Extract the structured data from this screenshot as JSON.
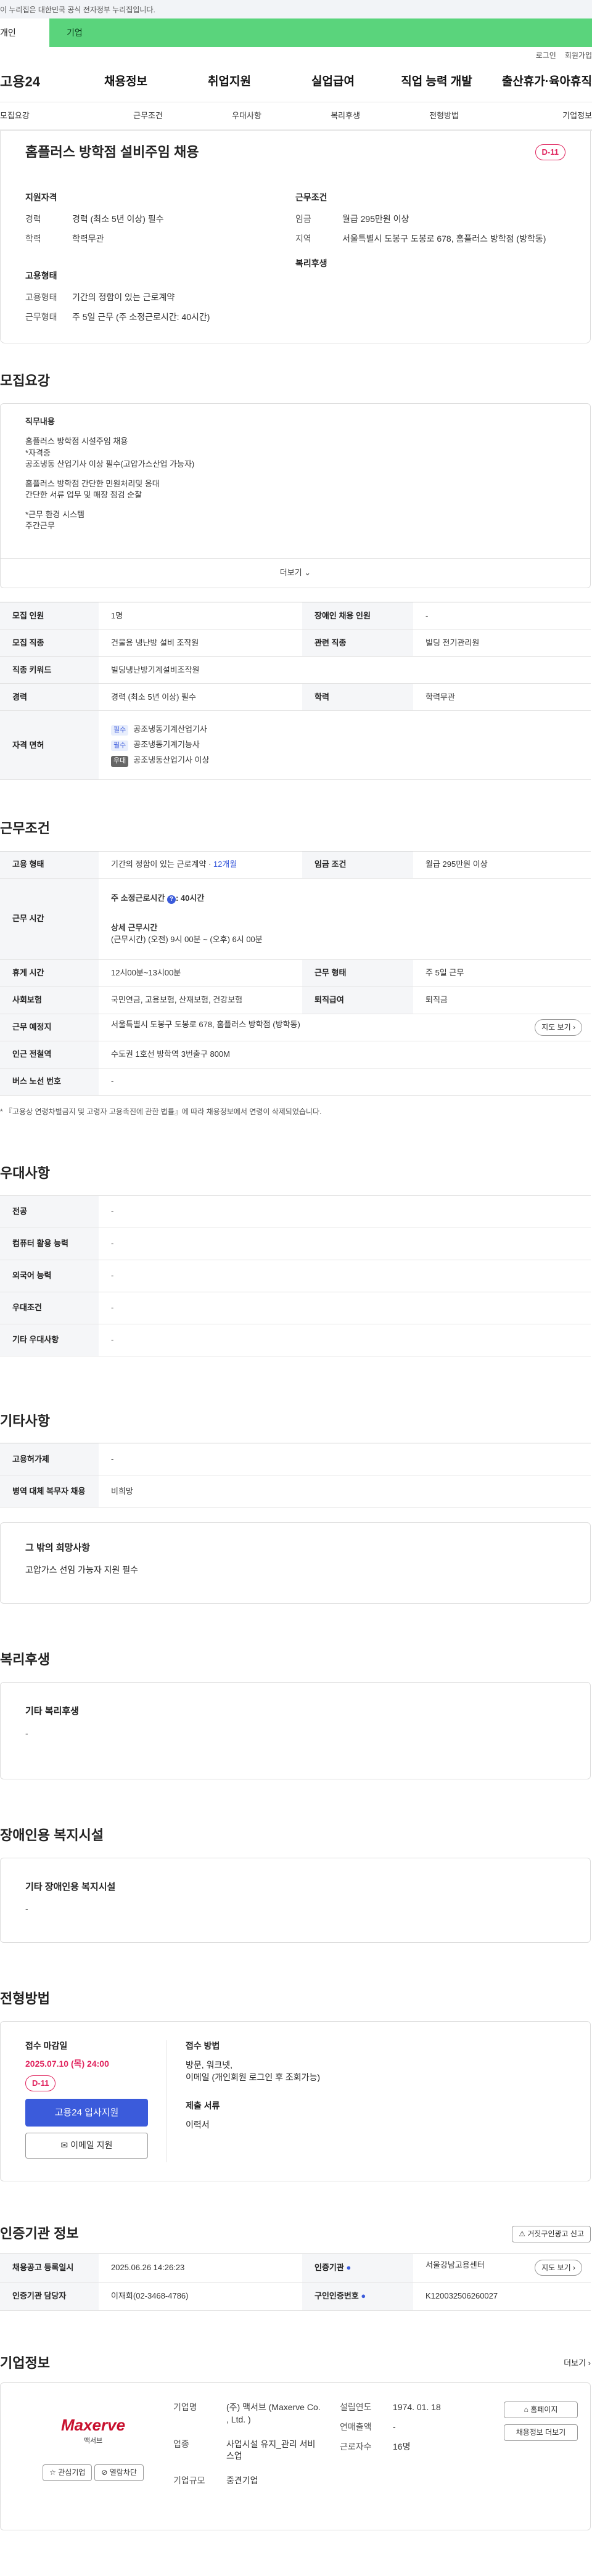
{
  "gov_banner": "이 누리집은 대한민국 공식 전자정부 누리집입니다.",
  "top_tabs": [
    "개인",
    "기업"
  ],
  "util_links": [
    "로그인",
    "회원가입"
  ],
  "logo": "고용24",
  "gnb": [
    "채용정보",
    "취업지원",
    "실업급여",
    "직업 능력 개발",
    "출산휴가·육아휴직"
  ],
  "anchor_tabs": [
    "모집요강",
    "근무조건",
    "우대사항",
    "복리후생",
    "전형방법",
    "기업정보"
  ],
  "summary": {
    "title": "홈플러스 방학점 설비주임 채용",
    "dday": "D-11",
    "qual_head": "지원자격",
    "qual": [
      {
        "k": "경력",
        "v": "경력 (최소 5년 이상) 필수"
      },
      {
        "k": "학력",
        "v": "학력무관"
      }
    ],
    "cond_head": "근무조건",
    "cond": [
      {
        "k": "임금",
        "v": "월급 295만원 이상"
      },
      {
        "k": "지역",
        "v": "서울특별시 도봉구 도봉로 678, 홈플러스 방학점 (방학동)"
      }
    ],
    "emp_head": "고용형태",
    "emp": [
      {
        "k": "고용형태",
        "v": "기간의 정함이 있는 근로계약"
      },
      {
        "k": "근무형태",
        "v": "주 5일 근무 (주 소정근로시간: 40시간)"
      }
    ],
    "welfare_head": "복리후생"
  },
  "recruit": {
    "title": "모집요강",
    "desc_lines": [
      "직무내용",
      "",
      "홈플러스 방학점 시설주임   채용",
      "*자격증",
      "공조냉동 산업기사 이상 필수(고압가스산업 가능자)",
      "",
      "홈플러스 방학점 간단한 민원처리및 응대",
      "간단한 서류 업무 및 매장 점검 순찰",
      "",
      "*근무 환경 시스템",
      "주간근무"
    ],
    "more": "더보기",
    "rows": [
      {
        "k1": "모집 인원",
        "v1": "1명",
        "k2": "장애인 채용 인원",
        "v2": "-"
      },
      {
        "k1": "모집 직종",
        "v1": "건물용 냉난방 설비 조작원",
        "k2": "관련 직종",
        "v2": "빌딩 전기관리원"
      },
      {
        "k1": "직종 키워드",
        "v1": "빌딩냉난방기계설비조작원",
        "k2": "",
        "v2": ""
      },
      {
        "k1": "경력",
        "v1": "경력 (최소 5년 이상) 필수",
        "k2": "학력",
        "v2": "학력무관"
      }
    ],
    "license_key": "자격 면허",
    "licenses": [
      {
        "tag": "필수",
        "name": "공조냉동기계산업기사"
      },
      {
        "tag": "필수",
        "name": "공조냉동기계기능사"
      },
      {
        "tag": "우대",
        "name": "공조냉동산업기사 이상"
      }
    ]
  },
  "work": {
    "title": "근무조건",
    "emp_type_k": "고용 형태",
    "emp_type_v": "기간의 정함이 있는 근로계약 · ",
    "emp_months": "12개월",
    "wage_k": "임금 조건",
    "wage_v": "월급 295만원 이상",
    "hours_k": "근무 시간",
    "hours_week": "주 소정근로시간",
    "hours_week_v": ": 40시간",
    "hours_detail_h": "상세 근무시간",
    "hours_detail_v": "(근무시간) (오전) 9시 00분 ~ (오후) 6시 00분",
    "rows": [
      {
        "k1": "휴게 시간",
        "v1": "12시00분~13시00분",
        "k2": "근무 형태",
        "v2": "주 5일 근무"
      },
      {
        "k1": "사회보험",
        "v1": "국민연금, 고용보험, 산재보험, 건강보험",
        "k2": "퇴직급여",
        "v2": "퇴직금"
      }
    ],
    "place_k": "근무 예정지",
    "place_v": "서울특별시 도봉구 도봉로 678, 홈플러스 방학점 (방학동)",
    "map_btn": "지도 보기",
    "subway_k": "인근 전철역",
    "subway_v": "수도권 1호선 방학역 3번출구 800M",
    "bus_k": "버스 노선 번호",
    "bus_v": "-",
    "note": "* 『고용상 연령차별금지 및 고령자 고용촉진에 관한 법률』에 따라 채용정보에서 연령이 삭제되었습니다."
  },
  "pref": {
    "title": "우대사항",
    "rows": [
      {
        "k": "전공",
        "v": "-"
      },
      {
        "k": "컴퓨터 활용 능력",
        "v": "-"
      },
      {
        "k": "외국어 능력",
        "v": "-"
      },
      {
        "k": "우대조건",
        "v": "-"
      },
      {
        "k": "기타 우대사항",
        "v": "-"
      }
    ]
  },
  "etc": {
    "title": "기타사항",
    "rows": [
      {
        "k": "고용허가제",
        "v": "-"
      },
      {
        "k": "병역 대체 복무자 채용",
        "v": "비희망"
      }
    ],
    "wish_h": "그 밖의 희망사항",
    "wish_v": "고압가스 선임 가능자 지원 필수"
  },
  "welfare": {
    "title": "복리후생",
    "h": "기타 복리후생",
    "v": "-"
  },
  "disabled": {
    "title": "장애인용 복지시설",
    "h": "기타 장애인용 복지시설",
    "v": "-"
  },
  "process": {
    "title": "전형방법",
    "deadline_h": "접수 마감일",
    "deadline_v": "2025.07.10 (목) 24:00",
    "dday": "D-11",
    "apply_btn": "고용24 입사지원",
    "email_btn": "이메일 지원",
    "method_h": "접수 방법",
    "method_v1": "방문, 워크넷,",
    "method_v2": "이메일 (개인회원 로그인 후 조회가능)",
    "docs_h": "제출 서류",
    "docs_v": "이력서"
  },
  "agency": {
    "title": "인증기관 정보",
    "report_btn": "거짓구인광고 신고",
    "rows": [
      {
        "k1": "채용공고 등록일시",
        "v1": "2025.06.26 14:26:23",
        "k2": "인증기관",
        "v2": "서울강남고용센터"
      },
      {
        "k1": "인증기관 담당자",
        "v1": "이재희(02-3468-4786)",
        "k2": "구인인증번호",
        "v2": "K120032506260027"
      }
    ],
    "map_btn": "지도 보기"
  },
  "company": {
    "title": "기업정보",
    "more": "더보기",
    "logo": "Maxerve",
    "logo_sub": "맥서브",
    "fav_btn": "관심기업",
    "block_btn": "열람차단",
    "rows": [
      {
        "k": "기업명",
        "v": "(주) 맥서브 (Maxerve Co. , Ltd. )"
      },
      {
        "k": "업종",
        "v": "사업시설 유지_관리 서비스업"
      },
      {
        "k": "기업규모",
        "v": "중견기업"
      }
    ],
    "rows2": [
      {
        "k": "설립연도",
        "v": "1974. 01. 18"
      },
      {
        "k": "연매출액",
        "v": "-"
      },
      {
        "k": "근로자수",
        "v": "16명"
      }
    ],
    "home_btn": "홈페이지",
    "jobs_btn": "채용정보 더보기"
  }
}
